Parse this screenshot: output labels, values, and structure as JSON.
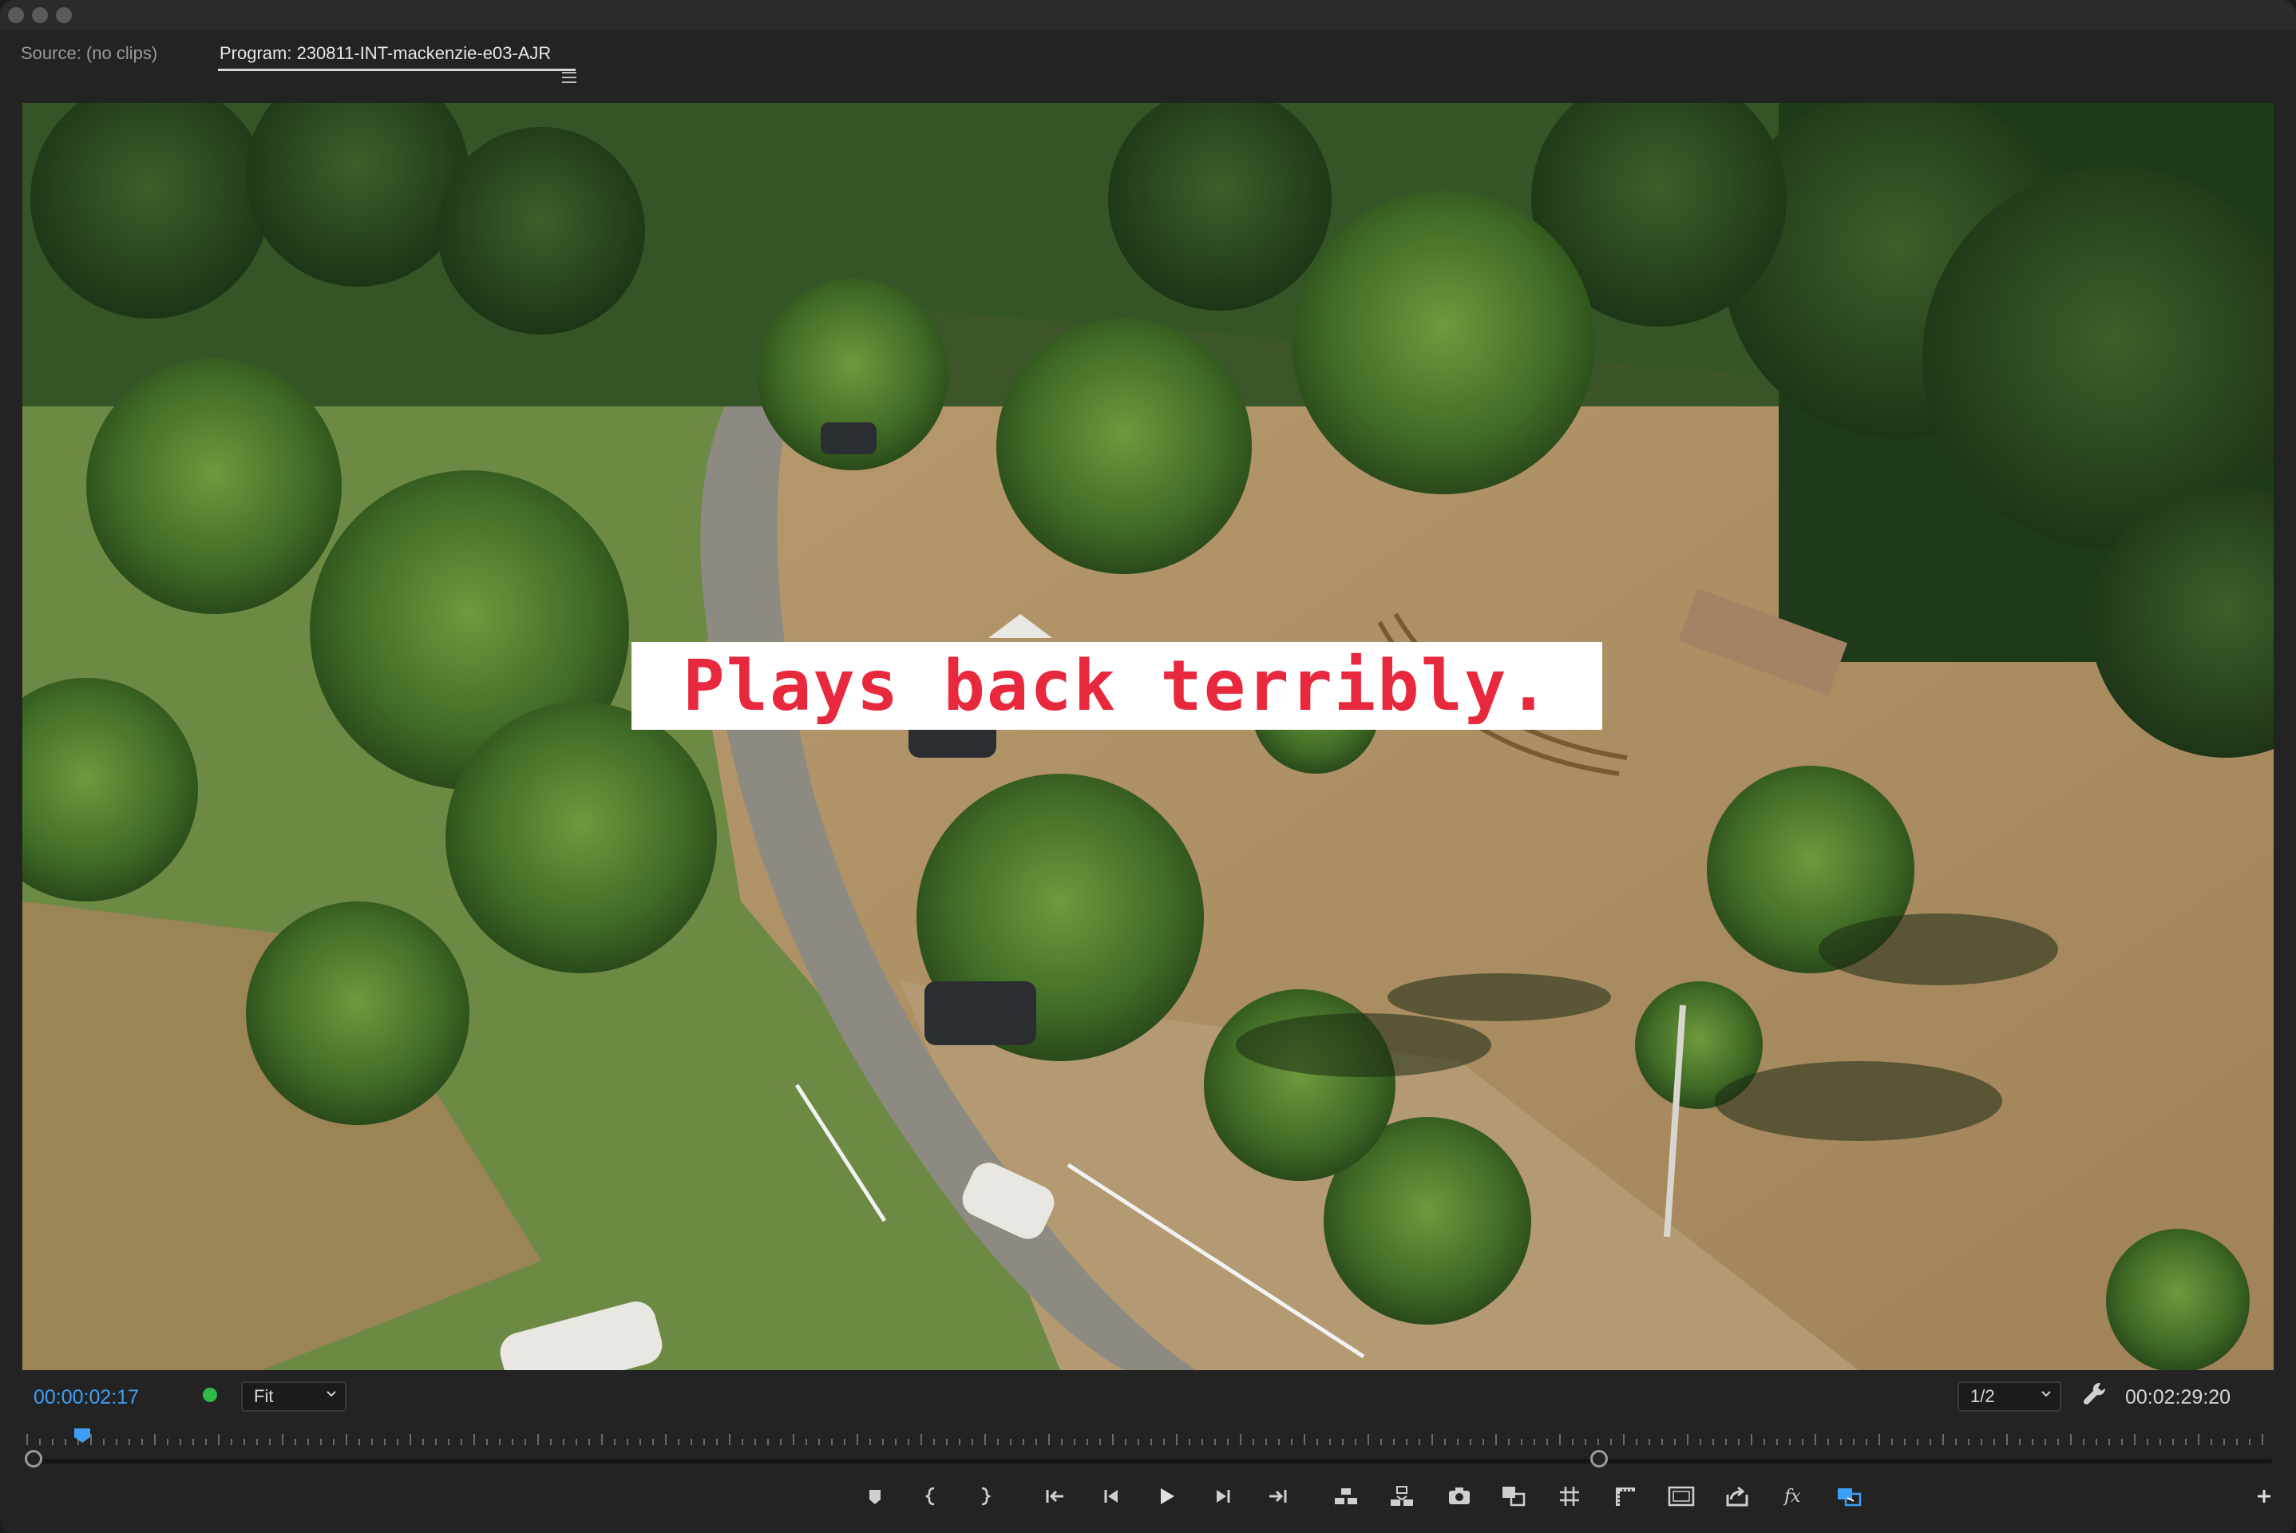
{
  "tabs": {
    "source": "Source: (no clips)",
    "program": "Program: 230811-INT-mackenzie-e03-AJR"
  },
  "video": {
    "caption": "Plays back terribly."
  },
  "controls": {
    "current_time": "00:00:02:17",
    "zoom": "Fit",
    "resolution": "1/2",
    "duration": "00:02:29:20"
  },
  "icons": {
    "menu": "hamburger-menu-icon",
    "wrench": "wrench-icon",
    "marker": "marker-icon",
    "mark_in": "mark-in-icon",
    "mark_out": "mark-out-icon",
    "go_to_in": "go-to-in-icon",
    "step_back": "step-back-icon",
    "play": "play-icon",
    "step_forward": "step-forward-icon",
    "go_to_out": "go-to-out-icon",
    "lift": "lift-icon",
    "extract": "extract-icon",
    "export_frame": "camera-icon",
    "comparison": "comparison-view-icon",
    "safe_margins": "safe-margins-icon",
    "rulers": "rulers-icon",
    "overlays": "overlays-icon",
    "export": "export-icon",
    "fx": "fx-icon",
    "vr": "vr-video-icon",
    "add": "plus-icon"
  },
  "colors": {
    "timecode_accent": "#3d9ff5",
    "status_green": "#2fba48",
    "caption_red": "#e8283c"
  }
}
